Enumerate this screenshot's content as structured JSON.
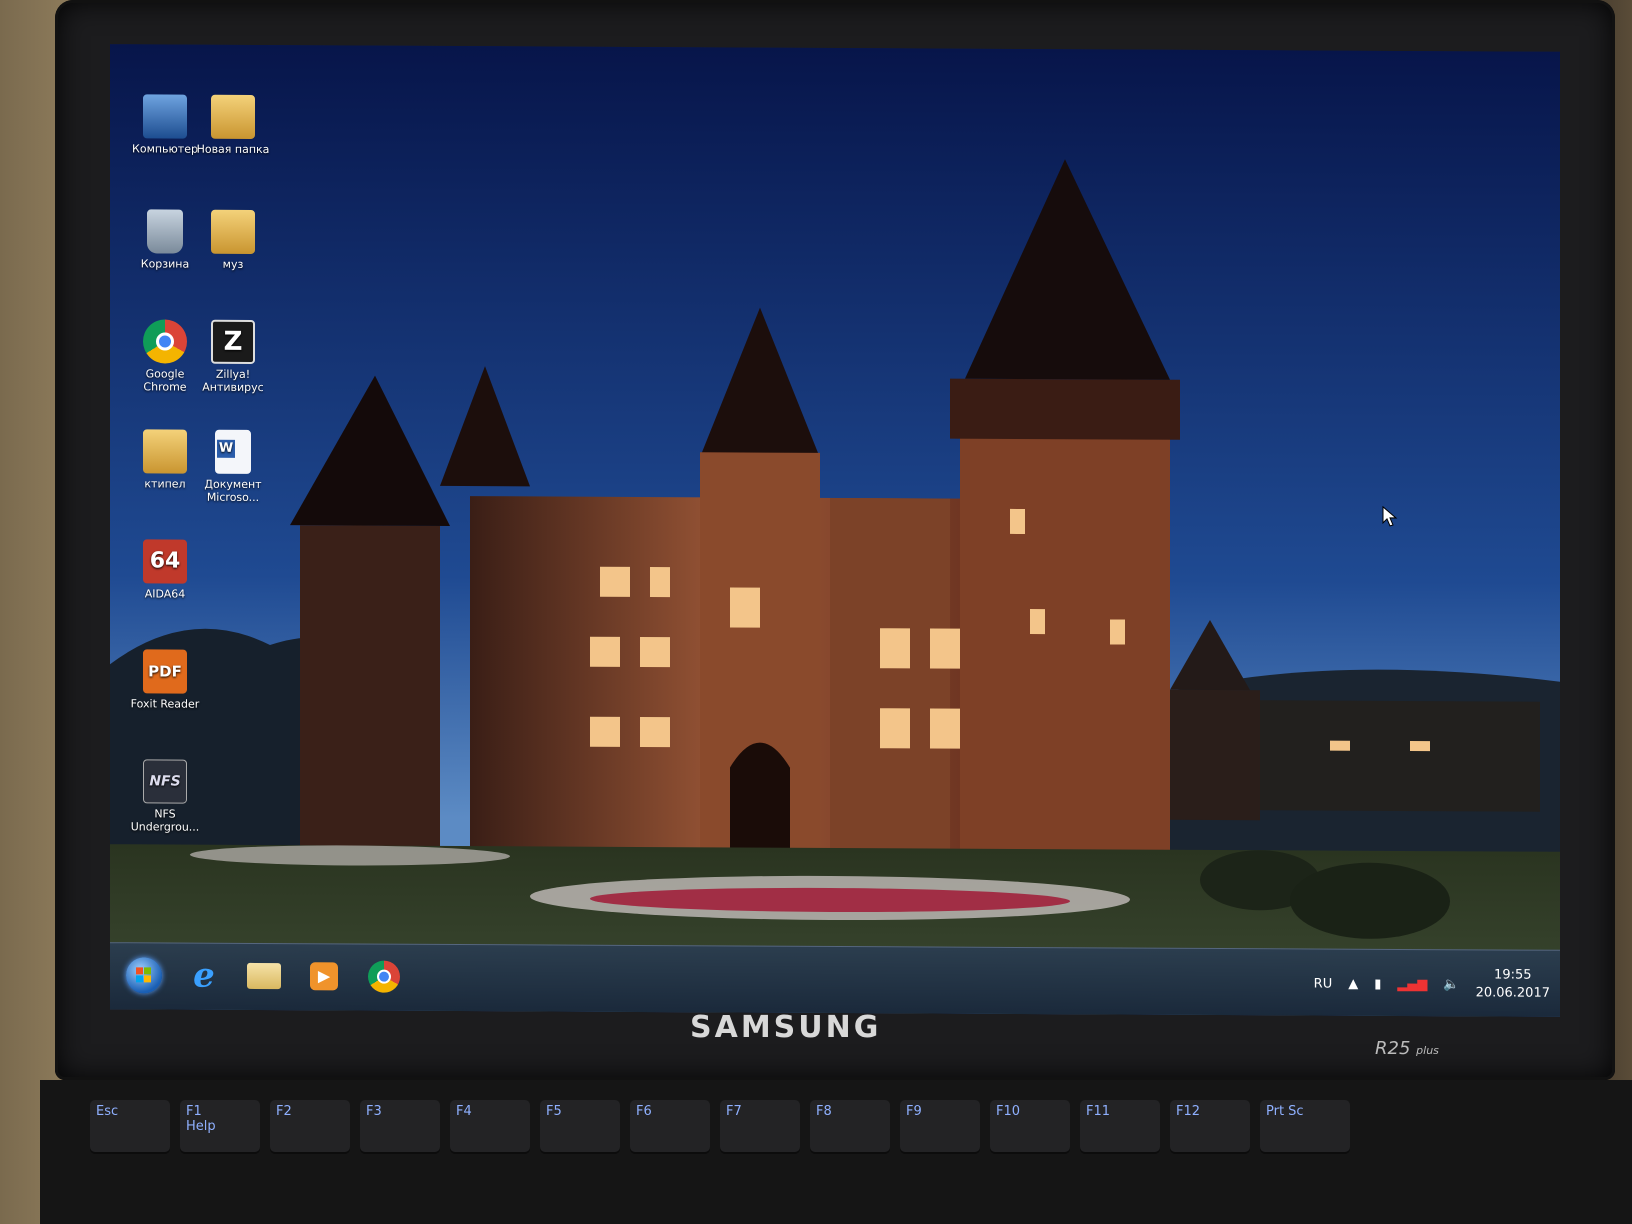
{
  "desktop_icons": [
    {
      "label": "Компьютер",
      "icon": "computer-icon"
    },
    {
      "label": "Новая папка",
      "icon": "folder-icon"
    },
    {
      "label": "Корзина",
      "icon": "recycle-bin-icon"
    },
    {
      "label": "муз",
      "icon": "folder-icon"
    },
    {
      "label": "Google Chrome",
      "icon": "chrome-icon"
    },
    {
      "label": "Zillya! Антивирус",
      "icon": "antivirus-icon"
    },
    {
      "label": "ктипел",
      "icon": "folder-icon"
    },
    {
      "label": "Документ Microso...",
      "icon": "word-document-icon"
    },
    {
      "label": "AIDA64",
      "icon": "aida64-icon"
    },
    {
      "label": "Foxit Reader",
      "icon": "pdf-reader-icon"
    },
    {
      "label": "NFS Undergrou...",
      "icon": "game-icon"
    }
  ],
  "taskbar": {
    "pinned": [
      "start-button",
      "internet-explorer-icon",
      "file-explorer-icon",
      "media-player-icon",
      "chrome-icon"
    ],
    "tray": {
      "language": "RU",
      "time": "19:55",
      "date": "20.06.2017"
    }
  },
  "laptop": {
    "brand": "SAMSUNG",
    "model": "R25",
    "model_suffix": "plus"
  },
  "keyboard": {
    "fn_keys": [
      "Esc",
      "F1",
      "F2",
      "F3",
      "F4",
      "F5",
      "F6",
      "F7",
      "F8",
      "F9",
      "F10",
      "F11",
      "F12",
      "Prt Sc"
    ],
    "f1_sub": "Help"
  },
  "colors": {
    "sky_top": "#07154a",
    "sky_bottom": "#3d6fb0",
    "castle": "#7a3e26",
    "accent": "#8fb0ff"
  }
}
